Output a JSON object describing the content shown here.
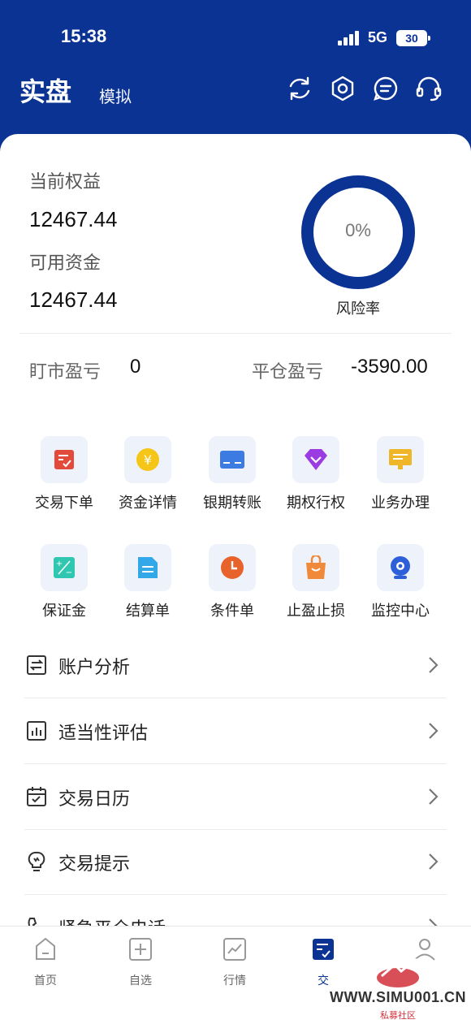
{
  "status": {
    "time": "15:38",
    "network": "5G",
    "battery": "30"
  },
  "header": {
    "title": "实盘",
    "subtitle": "模拟",
    "icons": [
      "refresh-icon",
      "settings-icon",
      "message-icon",
      "headset-icon"
    ]
  },
  "account": {
    "equity_label": "当前权益",
    "equity_value": "12467.44",
    "available_label": "可用资金",
    "available_value": "12467.44",
    "risk_value": "0%",
    "risk_label": "风险率",
    "float_pl_label": "盯市盈亏",
    "float_pl_value": "0",
    "close_pl_label": "平仓盈亏",
    "close_pl_value": "-3590.00"
  },
  "grid": [
    {
      "label": "交易下单",
      "icon": "order-icon",
      "color": "#e24a3b"
    },
    {
      "label": "资金详情",
      "icon": "yuan-coin-icon",
      "color": "#f5c518"
    },
    {
      "label": "银期转账",
      "icon": "card-icon",
      "color": "#3b7be2"
    },
    {
      "label": "期权行权",
      "icon": "diamond-icon",
      "color": "#9b3be2"
    },
    {
      "label": "业务办理",
      "icon": "monitor-icon",
      "color": "#f0b62a"
    },
    {
      "label": "保证金",
      "icon": "calculator-icon",
      "color": "#2fc7b0"
    },
    {
      "label": "结算单",
      "icon": "document-icon",
      "color": "#33a8e8"
    },
    {
      "label": "条件单",
      "icon": "clock-icon",
      "color": "#e8622c"
    },
    {
      "label": "止盈止损",
      "icon": "bag-icon",
      "color": "#f08a3a"
    },
    {
      "label": "监控中心",
      "icon": "camera-icon",
      "color": "#2d5fd8"
    }
  ],
  "menu": [
    {
      "label": "账户分析",
      "icon": "exchange-icon"
    },
    {
      "label": "适当性评估",
      "icon": "bar-chart-icon"
    },
    {
      "label": "交易日历",
      "icon": "calendar-icon"
    },
    {
      "label": "交易提示",
      "icon": "bulb-icon"
    },
    {
      "label": "紧急平仓电话",
      "icon": "phone-icon"
    }
  ],
  "tabs": [
    {
      "label": "首页",
      "icon": "home-icon"
    },
    {
      "label": "自选",
      "icon": "add-box-icon"
    },
    {
      "label": "行情",
      "icon": "trend-icon"
    },
    {
      "label": "交",
      "icon": "trade-icon",
      "active": true
    },
    {
      "label": "",
      "icon": "user-icon"
    }
  ],
  "watermark": {
    "text": "WWW.SIMU001.CN",
    "sub": "私募社区"
  },
  "colors": {
    "primary": "#0b3394",
    "background": "#ffffff"
  }
}
